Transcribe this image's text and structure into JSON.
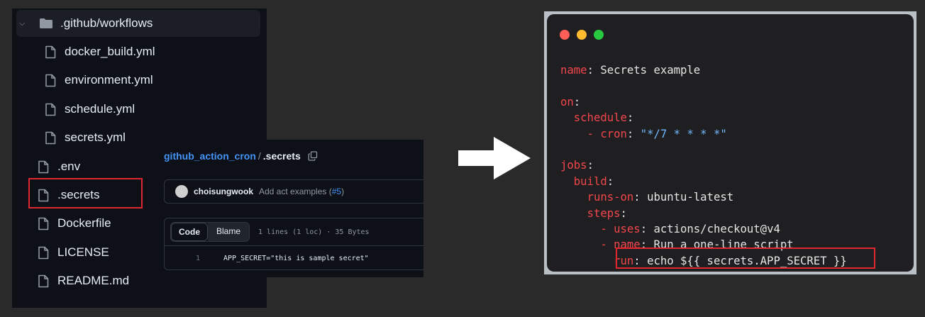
{
  "tree": {
    "folder": ".github/workflows",
    "workflow_files": [
      "docker_build.yml",
      "environment.yml",
      "schedule.yml",
      "secrets.yml"
    ],
    "root_files": [
      ".env",
      ".secrets",
      "Dockerfile",
      "LICENSE",
      "README.md"
    ],
    "highlighted": ".secrets"
  },
  "github": {
    "repo": "github_action_cron",
    "separator": "/",
    "file": ".secrets",
    "commit": {
      "author": "choisungwook",
      "message": "Add act examples (",
      "link": "#5",
      "message_end": ")"
    },
    "tabs": [
      "Code",
      "Blame"
    ],
    "meta": "1 lines (1 loc) · 35 Bytes",
    "lines": [
      {
        "number": "1",
        "text": "APP_SECRET=\"this is sample secret\""
      }
    ]
  },
  "card": {
    "window_dot_colors": [
      "#ff5f57",
      "#febc2e",
      "#28c840"
    ],
    "code": {
      "name_key": "name",
      "name_val": "Secrets example",
      "on_key": "on",
      "schedule_key": "schedule",
      "cron_key": "cron",
      "cron_val": "\"*/7 * * * *\"",
      "jobs_key": "jobs",
      "build_key": "build",
      "runs_on_key": "runs-on",
      "runs_on_val": "ubuntu-latest",
      "steps_key": "steps",
      "uses_key": "uses",
      "uses_val": "actions/checkout@v4",
      "step_name_key": "name",
      "step_name_val": "Run a one-line script",
      "run_key": "run",
      "run_val": "echo ${{ secrets.APP_SECRET }}"
    }
  },
  "colors": {
    "highlight_border": "#e1262f",
    "link": "#4493f8",
    "yaml_key": "#f2464d"
  }
}
